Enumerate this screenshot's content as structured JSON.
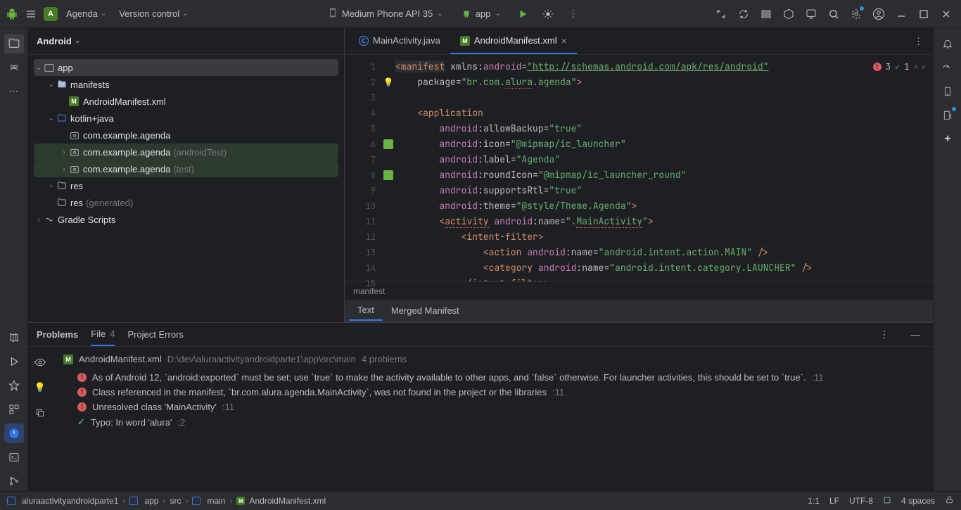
{
  "top": {
    "project": "Agenda",
    "proj_letter": "A",
    "vcs": "Version control",
    "device": "Medium Phone API 35",
    "config": "app"
  },
  "project_panel": {
    "title": "Android",
    "app": "app",
    "manifests": "manifests",
    "mfile": "AndroidManifest.xml",
    "kotlin": "kotlin+java",
    "pkg1": "com.example.agenda",
    "pkg2": "com.example.agenda",
    "pkg2s": "(androidTest)",
    "pkg3": "com.example.agenda",
    "pkg3s": "(test)",
    "res": "res",
    "resgen": "res",
    "resgens": "(generated)",
    "gradle": "Gradle Scripts"
  },
  "tabs": {
    "t1": "MainActivity.java",
    "t2": "AndroidManifest.xml"
  },
  "code": {
    "l1_a": "<manifest",
    "l1_b": " xmlns:",
    "l1_c": "android",
    "l1_d": "=",
    "l1_e": "\"http://schemas.android.com/apk/res/android\"",
    "l2_a": "    package",
    "l2_b": "=",
    "l2_c": "\"br.com.",
    "l2_d": "alura",
    "l2_e": ".agenda\"",
    "l2_f": ">",
    "l4_a": "    <application",
    "l5_a": "        ",
    "l5_b": "android",
    "l5_c": ":allowBackup=",
    "l5_d": "\"true\"",
    "l6_a": "        ",
    "l6_b": "android",
    "l6_c": ":icon=",
    "l6_d": "\"@mipmap/ic_launcher\"",
    "l7_a": "        ",
    "l7_b": "android",
    "l7_c": ":label=",
    "l7_d": "\"Agenda\"",
    "l8_a": "        ",
    "l8_b": "android",
    "l8_c": ":roundIcon=",
    "l8_d": "\"@mipmap/ic_launcher_round\"",
    "l9_a": "        ",
    "l9_b": "android",
    "l9_c": ":supportsRtl=",
    "l9_d": "\"true\"",
    "l10_a": "        ",
    "l10_b": "android",
    "l10_c": ":theme=",
    "l10_d": "\"@style/Theme.Agenda\"",
    "l10_e": ">",
    "l11_a": "        <",
    "l11_b": "activity",
    "l11_c": " ",
    "l11_d": "android",
    "l11_e": ":name=",
    "l11_f": "\".",
    "l11_g": "MainActivity",
    "l11_h": "\"",
    "l11_i": ">",
    "l12_a": "            <intent-filter>",
    "l13_a": "                <action ",
    "l13_b": "android",
    "l13_c": ":name=",
    "l13_d": "\"android.intent.action.MAIN\"",
    "l13_e": " />",
    "l14_a": "                <category ",
    "l14_b": "android",
    "l14_c": ":name=",
    "l14_d": "\"android.intent.category.LAUNCHER\"",
    "l14_e": " />",
    "l15_a": "            </intent-filter>"
  },
  "err": {
    "e": "3",
    "t": "1"
  },
  "crumb": "manifest",
  "sub_tabs": {
    "text": "Text",
    "merged": "Merged Manifest"
  },
  "problems": {
    "tab1": "Problems",
    "tab2": "File",
    "tab2c": "4",
    "tab3": "Project Errors",
    "file": "AndroidManifest.xml",
    "path": "D:\\dev\\aluraactivityandroidparte1\\app\\src\\main",
    "count": "4 problems",
    "p1": "As of Android 12, `android:exported` must be set; use `true` to make the activity available to other apps, and `false` otherwise. For launcher activities, this should be set to `true`.",
    "p1n": ":11",
    "p2": "Class referenced in the manifest, `br.com.alura.agenda.MainActivity`, was not found in the project or the libraries",
    "p2n": ":11",
    "p3": "Unresolved class 'MainActivity'",
    "p3n": ":11",
    "p4": "Typo: In word 'alura'",
    "p4n": ":2"
  },
  "status": {
    "c0": "aluraactivityandroidparte1",
    "c1": "app",
    "c2": "src",
    "c3": "main",
    "c4": "AndroidManifest.xml",
    "pos": "1:1",
    "lf": "LF",
    "enc": "UTF-8",
    "indent": "4 spaces"
  }
}
